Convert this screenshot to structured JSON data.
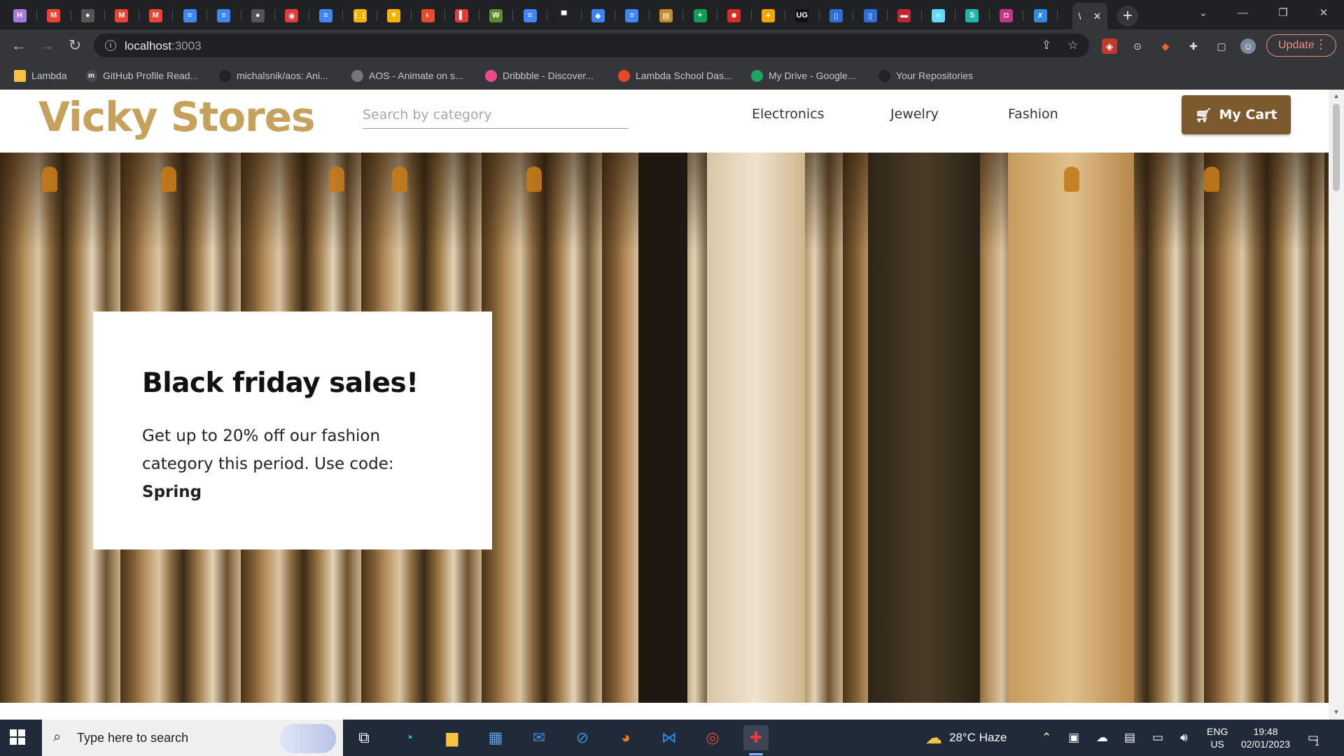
{
  "browser": {
    "tabs": [
      {
        "icon": "h-icon",
        "glyph": "H",
        "color": "#a87bd8"
      },
      {
        "icon": "gmail-icon",
        "glyph": "M",
        "color": "#ea4335"
      },
      {
        "icon": "github-icon",
        "glyph": "●",
        "color": "#555555"
      },
      {
        "icon": "gmail-icon",
        "glyph": "M",
        "color": "#ea4335"
      },
      {
        "icon": "gmail-icon",
        "glyph": "M",
        "color": "#ea4335"
      },
      {
        "icon": "docs-icon",
        "glyph": "≡",
        "color": "#4285f4"
      },
      {
        "icon": "docs-icon",
        "glyph": "≡",
        "color": "#4285f4"
      },
      {
        "icon": "github-icon",
        "glyph": "●",
        "color": "#555555"
      },
      {
        "icon": "app-icon",
        "glyph": "◉",
        "color": "#e23b3b"
      },
      {
        "icon": "docs-icon",
        "glyph": "≡",
        "color": "#4285f4"
      },
      {
        "icon": "grid-icon",
        "glyph": "⋮⋮",
        "color": "#f4b400"
      },
      {
        "icon": "shield-icon",
        "glyph": "▼",
        "color": "#f4b400"
      },
      {
        "icon": "app-icon",
        "glyph": "◐",
        "color": "#e54c2e"
      },
      {
        "icon": "bookmark-icon",
        "glyph": "▌",
        "color": "#e23b3b"
      },
      {
        "icon": "w-icon",
        "glyph": "W",
        "color": "#5c8a2f"
      },
      {
        "icon": "docs-icon",
        "glyph": "≡",
        "color": "#4285f4"
      },
      {
        "icon": "bar-icon",
        "glyph": "▀",
        "color": "#222222"
      },
      {
        "icon": "app-icon",
        "glyph": "◆",
        "color": "#3b82f6"
      },
      {
        "icon": "docs-icon",
        "glyph": "≡",
        "color": "#4285f4"
      },
      {
        "icon": "chart-icon",
        "glyph": "▤",
        "color": "#c68a2a"
      },
      {
        "icon": "plus-icon",
        "glyph": "+",
        "color": "#0f9d58"
      },
      {
        "icon": "leaf-icon",
        "glyph": "✹",
        "color": "#d62d20"
      },
      {
        "icon": "app-icon",
        "glyph": "✦",
        "color": "#f4a300"
      },
      {
        "icon": "ug-icon",
        "glyph": "UG",
        "color": "#111111"
      },
      {
        "icon": "app-icon",
        "glyph": "▯",
        "color": "#2e6ed6"
      },
      {
        "icon": "app-icon",
        "glyph": "▯",
        "color": "#2e6ed6"
      },
      {
        "icon": "app-icon",
        "glyph": "▬",
        "color": "#c0262c"
      },
      {
        "icon": "react-icon",
        "glyph": "⚛",
        "color": "#61dafb"
      },
      {
        "icon": "app-icon",
        "glyph": "S",
        "color": "#1fb7a6"
      },
      {
        "icon": "app-icon",
        "glyph": "◘",
        "color": "#c13584"
      },
      {
        "icon": "app-icon",
        "glyph": "✗",
        "color": "#2f8ae0"
      }
    ],
    "active_tab_label": "\\",
    "url_host": "localhost",
    "url_port": ":3003",
    "update_label": "Update",
    "bookmarks": [
      {
        "label": "Lambda",
        "icon": "folder-icon",
        "color": "#f6c343"
      },
      {
        "label": "GitHub Profile Read...",
        "icon": "markdown-icon",
        "color": "#4a4a4a",
        "glyph": "m"
      },
      {
        "label": "michalsnik/aos: Ani...",
        "icon": "github-icon",
        "color": "#222222"
      },
      {
        "label": "AOS - Animate on s...",
        "icon": "globe-icon",
        "color": "#777777"
      },
      {
        "label": "Dribbble - Discover...",
        "icon": "dribbble-icon",
        "color": "#ea4c89"
      },
      {
        "label": "Lambda School Das...",
        "icon": "lambda-icon",
        "color": "#e9462c"
      },
      {
        "label": "My Drive - Google...",
        "icon": "drive-icon",
        "color": "#1fa463"
      },
      {
        "label": "Your Repositories",
        "icon": "github-icon",
        "color": "#222222"
      }
    ]
  },
  "site": {
    "brand": "Vicky Stores",
    "search_placeholder": "Search by category",
    "nav": [
      "Electronics",
      "Jewelry",
      "Fashion"
    ],
    "cart_label": "My Cart",
    "promo": {
      "title": "Black friday sales!",
      "text": "Get up to 20% off our fashion category this period. Use code:",
      "code": "Spring"
    }
  },
  "taskbar": {
    "search_text": "Type here to search",
    "weather": "28°C  Haze",
    "lang_top": "ENG",
    "lang_bottom": "US",
    "time": "19:48",
    "date": "02/01/2023",
    "notifications": "1"
  }
}
